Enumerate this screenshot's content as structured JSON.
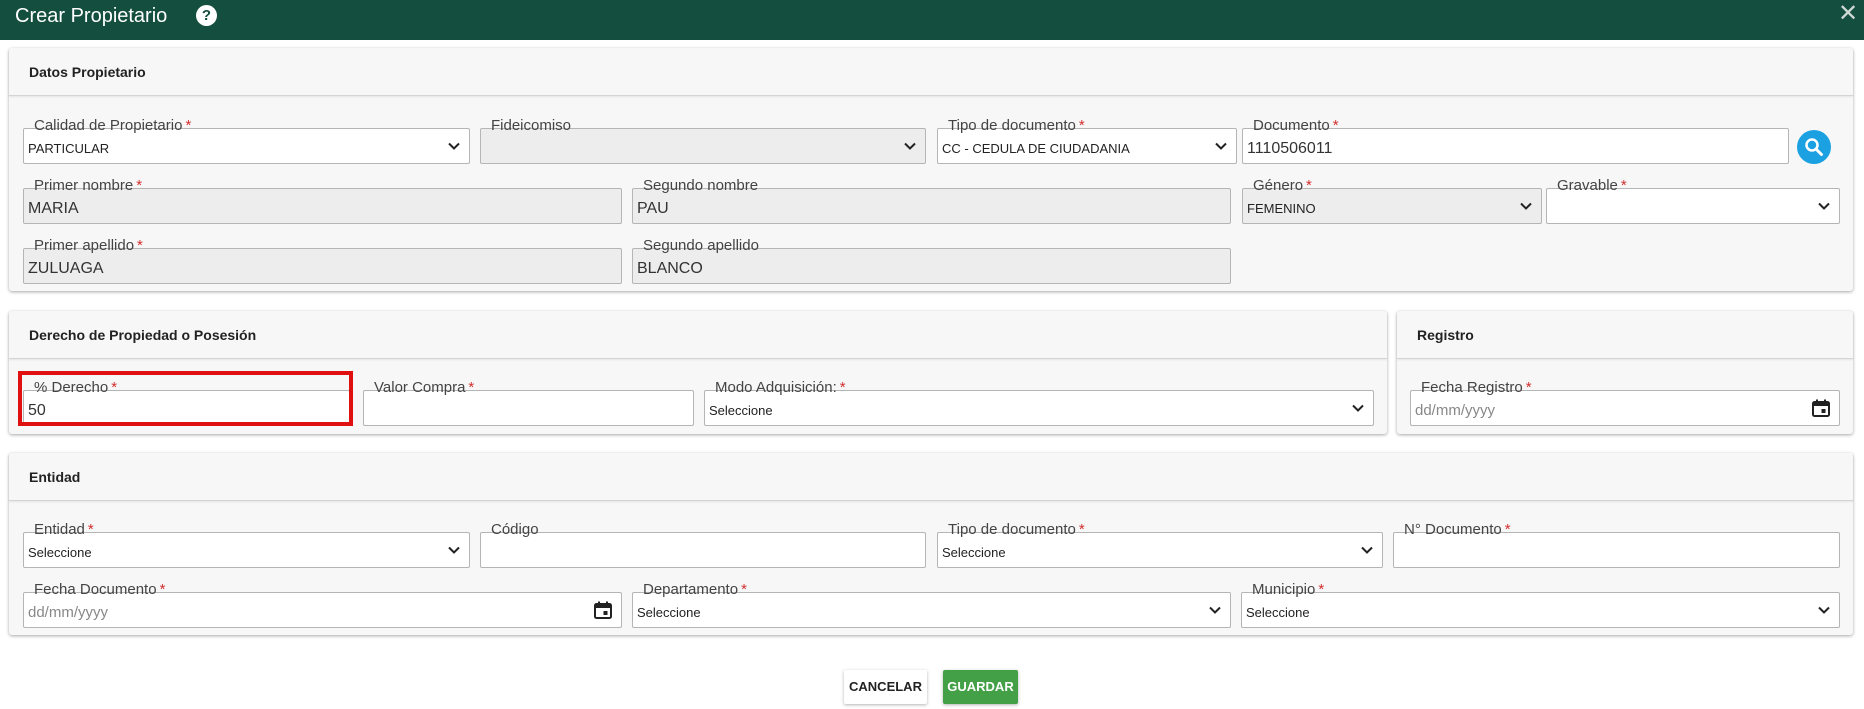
{
  "dialog": {
    "title": "Crear Propietario",
    "help": "?",
    "close": "✕"
  },
  "colors": {
    "header": "#134e3e",
    "search_button": "#1ba1e2",
    "save_button": "#43a047",
    "highlight": "#e01010",
    "required": "#d32f2f"
  },
  "owner": {
    "section_title": "Datos Propietario",
    "calidad": {
      "label": "Calidad de Propietario",
      "value": "PARTICULAR"
    },
    "fideicomiso": {
      "label": "Fideicomiso",
      "value": ""
    },
    "tipo_documento": {
      "label": "Tipo de documento",
      "value": "CC - CEDULA DE CIUDADANIA"
    },
    "documento": {
      "label": "Documento",
      "value": "1110506011"
    },
    "primer_nombre": {
      "label": "Primer nombre",
      "value": "MARIA"
    },
    "segundo_nombre": {
      "label": "Segundo nombre",
      "value": "PAU"
    },
    "genero": {
      "label": "Género",
      "value": "FEMENINO"
    },
    "gravable": {
      "label": "Gravable",
      "value": ""
    },
    "primer_apellido": {
      "label": "Primer apellido",
      "value": "ZULUAGA"
    },
    "segundo_apellido": {
      "label": "Segundo apellido",
      "value": "BLANCO"
    }
  },
  "rights": {
    "section_title": "Derecho de Propiedad o Posesión",
    "porcentaje": {
      "label": "% Derecho",
      "value": "50"
    },
    "valor_compra": {
      "label": "Valor Compra",
      "value": ""
    },
    "modo": {
      "label": "Modo Adquisición:",
      "value": "Seleccione"
    }
  },
  "registry": {
    "section_title": "Registro",
    "fecha": {
      "label": "Fecha Registro",
      "placeholder": "dd/mm/yyyy"
    }
  },
  "entity": {
    "section_title": "Entidad",
    "entidad": {
      "label": "Entidad",
      "value": "Seleccione"
    },
    "codigo": {
      "label": "Código",
      "value": ""
    },
    "tipo_documento": {
      "label": "Tipo de documento",
      "value": "Seleccione"
    },
    "numero_documento": {
      "label": "N° Documento",
      "value": ""
    },
    "fecha_documento": {
      "label": "Fecha Documento",
      "placeholder": "dd/mm/yyyy"
    },
    "departamento": {
      "label": "Departamento",
      "value": "Seleccione"
    },
    "municipio": {
      "label": "Municipio",
      "value": "Seleccione"
    }
  },
  "required_marker": "*",
  "actions": {
    "cancel": "CANCELAR",
    "save": "GUARDAR"
  }
}
